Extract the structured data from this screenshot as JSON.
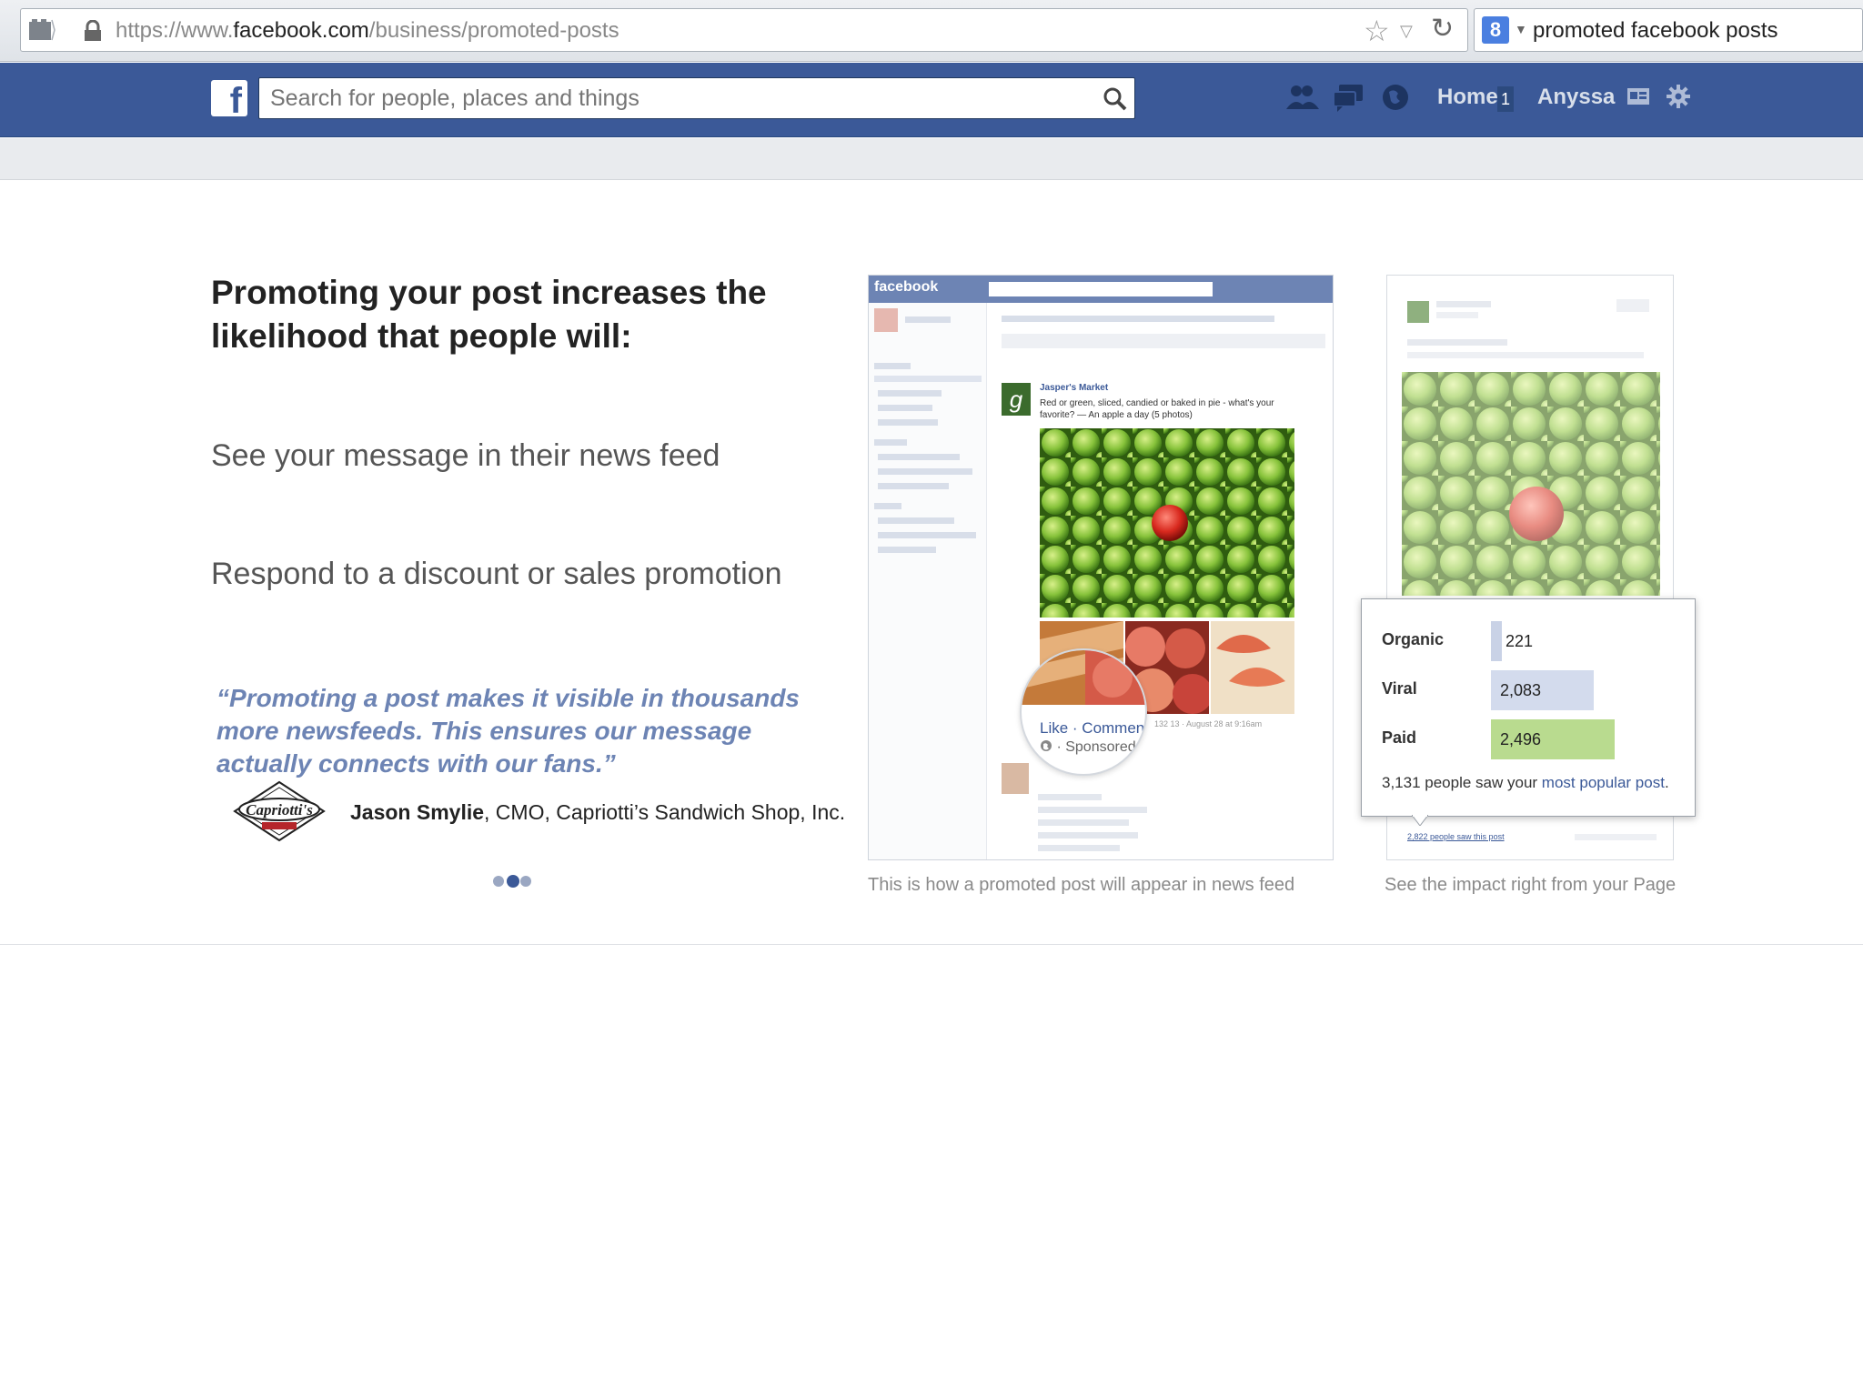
{
  "browser": {
    "url_prefix": "https://www.",
    "url_domain": "facebook.com",
    "url_path": "/business/promoted-posts",
    "search_query": "promoted facebook posts",
    "search_engine_letter": "8"
  },
  "facebook": {
    "search_placeholder": "Search for people, places and things",
    "home_label": "Home",
    "home_count": "1",
    "user_name": "Anyssa"
  },
  "content": {
    "headline": "Promoting your post increases the likelihood that people will:",
    "point1": "See your message in their news feed",
    "point2": "Respond to a discount or sales promotion",
    "quote": "“Promoting a post makes it visible in thousands more newsfeeds.  This ensures our message actually connects with our fans.”",
    "author_name": "Jason Smylie",
    "author_title": ", CMO, Capriotti’s Sandwich Shop, Inc.",
    "carousel_total": 3,
    "carousel_active": 2
  },
  "preview_newsfeed": {
    "logo": "facebook",
    "page_name": "Jasper's Market",
    "post_text": "Red or green, sliced, candied or baked in pie - what's your favorite? — An apple a day (5 photos)",
    "like_comment": "Like · Comment",
    "sponsored": "· Sponsored",
    "meta": "132  13 · August 28 at 9:16am",
    "caption": "This is how a promoted post will appear in news feed"
  },
  "preview_insights": {
    "link": "2,822 people saw this post",
    "stats": [
      {
        "label": "Organic",
        "value": "221",
        "reach": 221,
        "color": "#c9d2e6"
      },
      {
        "label": "Viral",
        "value": "2,083",
        "reach": 2083,
        "color": "#d3dbed"
      },
      {
        "label": "Paid",
        "value": "2,496",
        "reach": 2496,
        "color": "#b9db8f"
      }
    ],
    "summary_prefix": "3,131 people saw your ",
    "summary_link": "most popular post",
    "summary_suffix": ".",
    "caption": "See the impact right from your Page"
  }
}
